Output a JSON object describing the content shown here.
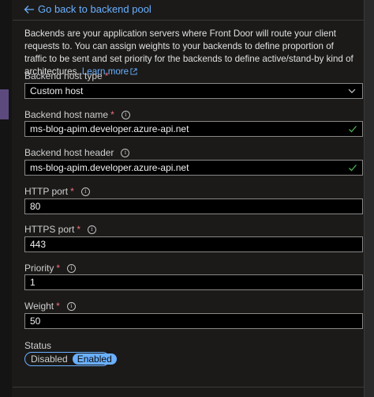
{
  "back_link": "Go back to backend pool",
  "intro": {
    "text": "Backends are your application servers where Front Door will route your client requests to. You can assign weights to your backends to define proportion of traffic to be sent and set priority for the backends to define active/stand-by kind of architectures.",
    "learn_more": "Learn more"
  },
  "fields": {
    "host_type": {
      "label": "Backend host type",
      "required_mark": "*",
      "value": "Custom host"
    },
    "host_name": {
      "label": "Backend host name",
      "required_mark": "*",
      "value": "ms-blog-apim.developer.azure-api.net"
    },
    "host_header": {
      "label": "Backend host header",
      "value": "ms-blog-apim.developer.azure-api.net"
    },
    "http_port": {
      "label": "HTTP port",
      "required_mark": "*",
      "value": "80"
    },
    "https_port": {
      "label": "HTTPS port",
      "required_mark": "*",
      "value": "443"
    },
    "priority": {
      "label": "Priority",
      "required_mark": "*",
      "value": "1"
    },
    "weight": {
      "label": "Weight",
      "required_mark": "*",
      "value": "50"
    }
  },
  "status": {
    "label": "Status",
    "options": [
      "Disabled",
      "Enabled"
    ],
    "selected": "Enabled"
  },
  "colors": {
    "accent": "#6ab0ff",
    "required": "#f1707b",
    "valid": "#4caf50"
  }
}
